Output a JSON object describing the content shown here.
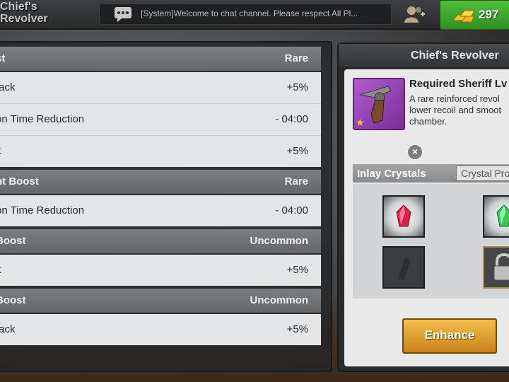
{
  "header": {
    "title_line1": "Chief's",
    "title_line2": "Revolver",
    "chat_message": "[System]Welcome to chat channel. Please respect All Pl...",
    "gold_amount": "297"
  },
  "boost_groups": [
    {
      "name": "st",
      "rarity": "Rare",
      "attributes": [
        {
          "name": "tack",
          "value": "+5%"
        },
        {
          "name": "on Time Reduction",
          "value": "- 04:00"
        },
        {
          "name": "k",
          "value": "+5%"
        }
      ]
    },
    {
      "name": "nt Boost",
      "rarity": "Rare",
      "attributes": [
        {
          "name": "on Time Reduction",
          "value": "- 04:00"
        }
      ]
    },
    {
      "name": "Boost",
      "rarity": "Uncommon",
      "attributes": [
        {
          "name": "k",
          "value": "+5%"
        }
      ]
    },
    {
      "name": "Boost",
      "rarity": "Uncommon",
      "attributes": [
        {
          "name": "tack",
          "value": "+5%"
        }
      ]
    }
  ],
  "item_panel": {
    "title": "Chief's Revolver",
    "required_label": "Required Sheriff Lv",
    "desc_line1": "A rare reinforced revol",
    "desc_line2": "lower recoil and smoot",
    "desc_line3": "chamber.",
    "inlay_label": "Inlay Crystals",
    "crystal_tab_label": "Crystal Pro",
    "remove_symbol": "×",
    "enhance_label": "Enhance"
  },
  "colors": {
    "gold_button": "#3aa72b",
    "enhance_button": "#e3a53a",
    "weapon_frame": "#9b45bc",
    "red_crystal": "#e0224a",
    "green_crystal": "#3ac85a"
  }
}
